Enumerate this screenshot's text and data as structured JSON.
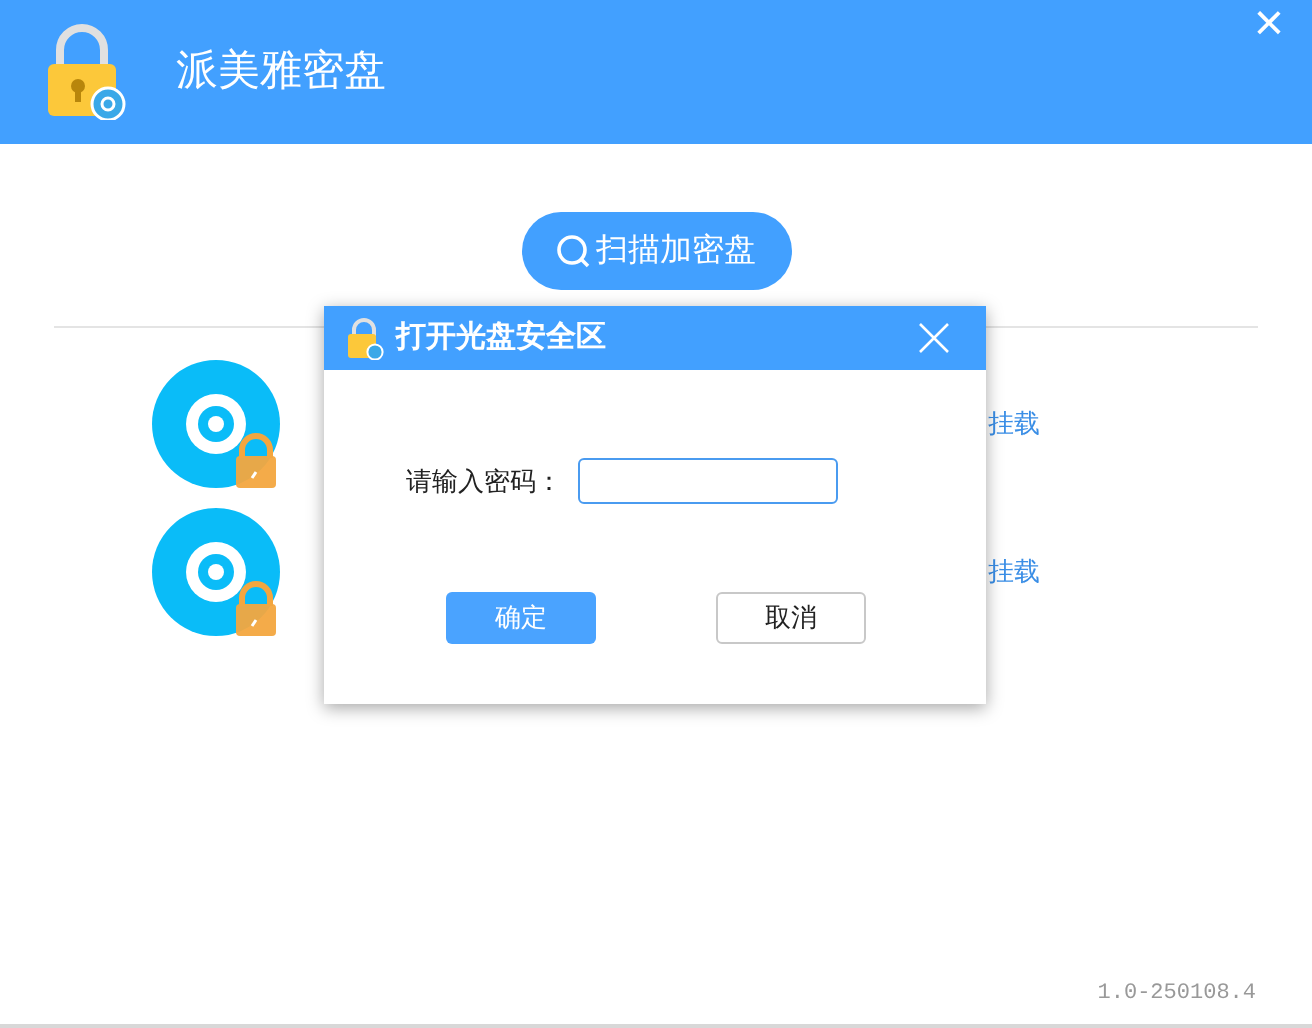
{
  "window": {
    "title": "派美雅密盘",
    "close": "×"
  },
  "scan_button": {
    "label": "扫描加密盘"
  },
  "discs": [
    {
      "action": "挂载",
      "locked": true
    },
    {
      "action": "挂载",
      "locked": true
    }
  ],
  "dialog": {
    "title": "打开光盘安全区",
    "password_label": "请输入密码：",
    "buttons": [
      {
        "label": "确定",
        "kind": "primary"
      },
      {
        "label": "取消",
        "kind": "secondary"
      }
    ]
  },
  "version": "1.0-250108.4"
}
